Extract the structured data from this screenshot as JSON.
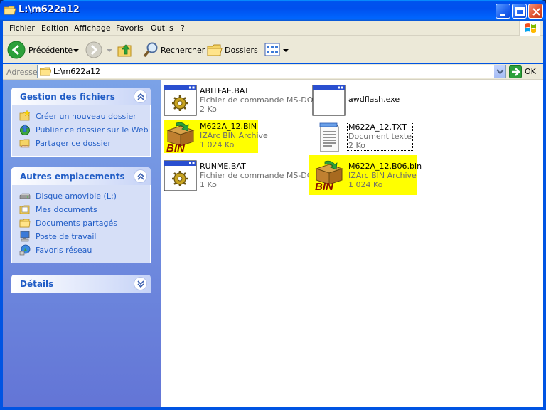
{
  "window": {
    "title": "L:\\m622a12"
  },
  "menu": [
    "Fichier",
    "Edition",
    "Affichage",
    "Favoris",
    "Outils",
    "?"
  ],
  "toolbar": {
    "back": "Précédente",
    "search": "Rechercher",
    "folders": "Dossiers"
  },
  "address": {
    "label": "Adresse",
    "value": "L:\\m622a12",
    "go": "OK"
  },
  "panels": {
    "file_tasks": {
      "title": "Gestion des fichiers",
      "items": [
        "Créer un nouveau dossier",
        "Publier ce dossier sur le Web",
        "Partager ce dossier"
      ]
    },
    "other_places": {
      "title": "Autres emplacements",
      "items": [
        "Disque amovible (L:)",
        "Mes documents",
        "Documents partagés",
        "Poste de travail",
        "Favoris réseau"
      ]
    },
    "details": {
      "title": "Détails"
    }
  },
  "files": [
    {
      "name": "ABITFAE.BAT",
      "type": "Fichier de commande MS-DOS",
      "size": "2 Ko",
      "icon": "batch-file-icon"
    },
    {
      "name": "awdflash.exe",
      "type": "",
      "size": "",
      "icon": "exe-window-icon"
    },
    {
      "name": "M622A_12.BIN",
      "type": "IZArc BIN Archive",
      "size": "1 024 Ko",
      "icon": "bin-archive-icon"
    },
    {
      "name": "M622A_12.TXT",
      "type": "Document texte",
      "size": "2 Ko",
      "icon": "notepad-icon"
    },
    {
      "name": "RUNME.BAT",
      "type": "Fichier de commande MS-DOS",
      "size": "1 Ko",
      "icon": "batch-file-icon"
    },
    {
      "name": "M622A_12.B06.bin",
      "type": "IZArc BIN Archive",
      "size": "1 024 Ko",
      "icon": "bin-archive-icon"
    }
  ],
  "colors": {
    "highlight": "#ffff00",
    "link": "#215dc6",
    "titlebar": "#0054e3"
  }
}
